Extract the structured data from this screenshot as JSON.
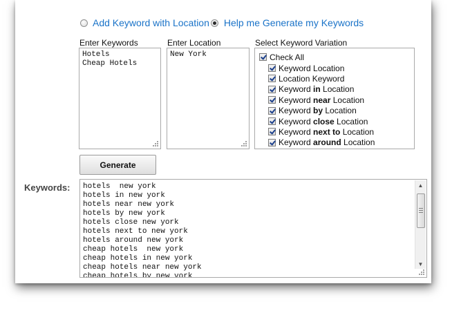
{
  "mode": {
    "options": [
      {
        "label": "Add Keyword with Location",
        "selected": false
      },
      {
        "label": "Help me Generate my Keywords",
        "selected": true
      }
    ]
  },
  "keywords_column": {
    "label": "Enter Keywords",
    "lines": [
      "Hotels",
      "Cheap Hotels"
    ]
  },
  "location_column": {
    "label": "Enter Location",
    "lines": [
      "New York"
    ]
  },
  "variation_column": {
    "label": "Select Keyword Variation",
    "check_all": {
      "label": "Check All",
      "checked": true
    },
    "items": [
      {
        "pre": "Keyword Location",
        "bold": "",
        "post": "",
        "checked": true
      },
      {
        "pre": "Location Keyword",
        "bold": "",
        "post": "",
        "checked": true
      },
      {
        "pre": "Keyword ",
        "bold": "in",
        "post": " Location",
        "checked": true
      },
      {
        "pre": "Keyword ",
        "bold": "near",
        "post": " Location",
        "checked": true
      },
      {
        "pre": "Keyword ",
        "bold": "by",
        "post": " Location",
        "checked": true
      },
      {
        "pre": "Keyword ",
        "bold": "close",
        "post": " Location",
        "checked": true
      },
      {
        "pre": "Keyword ",
        "bold": "next to",
        "post": " Location",
        "checked": true
      },
      {
        "pre": "Keyword ",
        "bold": "around",
        "post": " Location",
        "checked": true
      }
    ]
  },
  "generate_button": {
    "label": "Generate"
  },
  "output": {
    "label": "Keywords:",
    "lines": [
      "hotels  new york",
      "hotels in new york",
      "hotels near new york",
      "hotels by new york",
      "hotels close new york",
      "hotels next to new york",
      "hotels around new york",
      "cheap hotels  new york",
      "cheap hotels in new york",
      "cheap hotels near new york",
      "cheap hotels by new york"
    ]
  },
  "colors": {
    "link": "#1a73c8",
    "label": "#444444"
  }
}
